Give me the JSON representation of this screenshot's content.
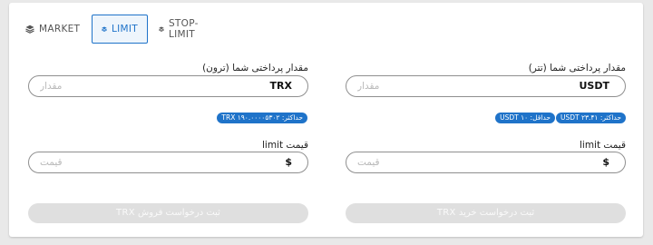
{
  "tabs": [
    {
      "label": "MARKET",
      "icon": "stack-icon",
      "active": false
    },
    {
      "label": "LIMIT",
      "icon": "stack-icon",
      "active": true
    },
    {
      "label": "STOP-LIMIT",
      "icon": "stack-icon",
      "active": false
    }
  ],
  "colors": {
    "accent": "#1f73c9",
    "disabled_button": "#dfdfdf",
    "field_border": "#8f8f8f"
  },
  "buy": {
    "amount_label": "مقدار پرداختی شما (تتر)",
    "amount_placeholder": "مقدار",
    "amount_currency": "USDT",
    "max_chip": "حداکثر: ۲۳.۴۱ USDT",
    "min_chip": "حداقل: ۱۰ USDT",
    "price_label": "قیمت limit",
    "price_placeholder": "قیمت",
    "price_currency": "$",
    "submit_label": "ثبت درخواست خرید TRX"
  },
  "sell": {
    "amount_label": "مقدار پرداختی شما (ترون)",
    "amount_placeholder": "مقدار",
    "amount_currency": "TRX",
    "max_chip": "حداکثر: ۱۹۰.۰۰۰۰۵۳۰۲ TRX",
    "price_label": "قیمت limit",
    "price_placeholder": "قیمت",
    "price_currency": "$",
    "submit_label": "ثبت درخواست فروش TRX"
  }
}
